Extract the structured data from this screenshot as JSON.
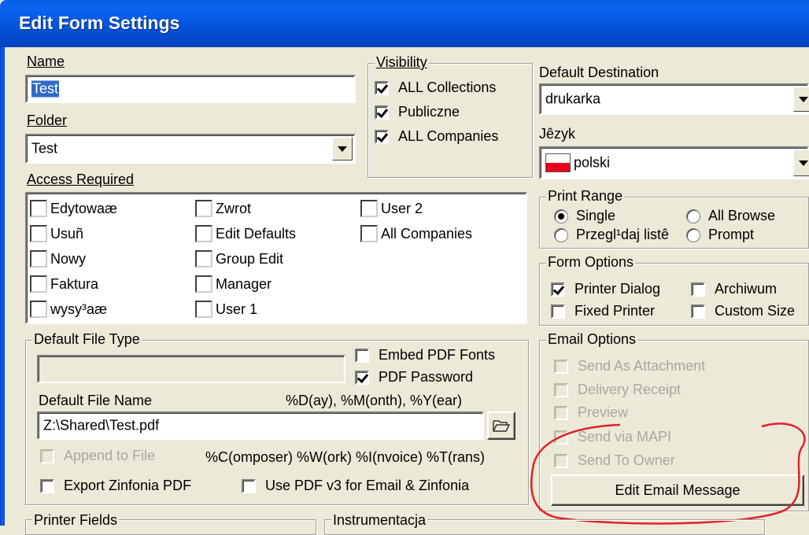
{
  "window": {
    "title": "Edit Form Settings"
  },
  "name": {
    "label": "Name",
    "value": "Test"
  },
  "folder": {
    "label": "Folder",
    "value": "Test"
  },
  "visibility": {
    "title": "Visibility",
    "items": [
      {
        "label": "ALL Collections",
        "checked": true
      },
      {
        "label": "Publiczne",
        "checked": true
      },
      {
        "label": "ALL Companies",
        "checked": true
      }
    ]
  },
  "default_destination": {
    "label": "Default Destination",
    "value": "drukarka"
  },
  "language": {
    "label": "Jêzyk",
    "value": "polski",
    "flag_colors": [
      "#FFFFFF",
      "#E8001C"
    ]
  },
  "access_required": {
    "title": "Access Required",
    "columns": [
      [
        "Edytowaæ",
        "Usuñ",
        "Nowy",
        "Faktura",
        "wysy³aæ"
      ],
      [
        "Zwrot",
        "Edit Defaults",
        "Group Edit",
        "Manager",
        "User 1"
      ],
      [
        "User 2",
        "All Companies"
      ]
    ]
  },
  "print_range": {
    "title": "Print Range",
    "options": [
      {
        "label": "Single",
        "selected": true
      },
      {
        "label": "All Browse",
        "selected": false
      },
      {
        "label": "Przegl¹daj listê",
        "selected": false
      },
      {
        "label": "Prompt",
        "selected": false
      }
    ]
  },
  "form_options": {
    "title": "Form Options",
    "items": [
      {
        "label": "Printer Dialog",
        "checked": true
      },
      {
        "label": "Archiwum",
        "checked": false
      },
      {
        "label": "Fixed Printer",
        "checked": false
      },
      {
        "label": "Custom Size",
        "checked": false
      }
    ]
  },
  "default_file_type": {
    "title": "Default File Type",
    "value": "",
    "embed_pdf_fonts": {
      "label": "Embed PDF Fonts",
      "checked": false
    },
    "pdf_password": {
      "label": "PDF Password",
      "checked": true
    },
    "file_name_label": "Default File Name",
    "hint1": "%D(ay), %M(onth), %Y(ear)",
    "file_name_value": "Z:\\Shared\\Test.pdf",
    "append_to_file": {
      "label": "Append to File",
      "checked": false,
      "disabled": true
    },
    "hint2": "%C(omposer) %W(ork) %I(nvoice) %T(rans)",
    "export_zinfonia": {
      "label": "Export Zinfonia PDF",
      "checked": false
    },
    "use_pdf_v3": {
      "label": "Use PDF v3 for Email & Zinfonia",
      "checked": false
    }
  },
  "email_options": {
    "title": "Email Options",
    "items": [
      {
        "label": "Send As Attachment",
        "disabled": true
      },
      {
        "label": "Delivery Receipt",
        "disabled": true
      },
      {
        "label": "Preview",
        "disabled": true
      },
      {
        "label": "Send via MAPI",
        "disabled": true
      },
      {
        "label": "Send To Owner",
        "disabled": true
      }
    ],
    "edit_button": "Edit Email Message",
    "highlight_color": "#E0202A"
  },
  "bottom_groups": {
    "printer_fields": "Printer Fields",
    "instrumentacja": "Instrumentacja"
  },
  "icons": {
    "folder_browse": "folder-open-icon",
    "dropdown": "chevron-down-icon",
    "flag": "poland-flag-icon"
  }
}
